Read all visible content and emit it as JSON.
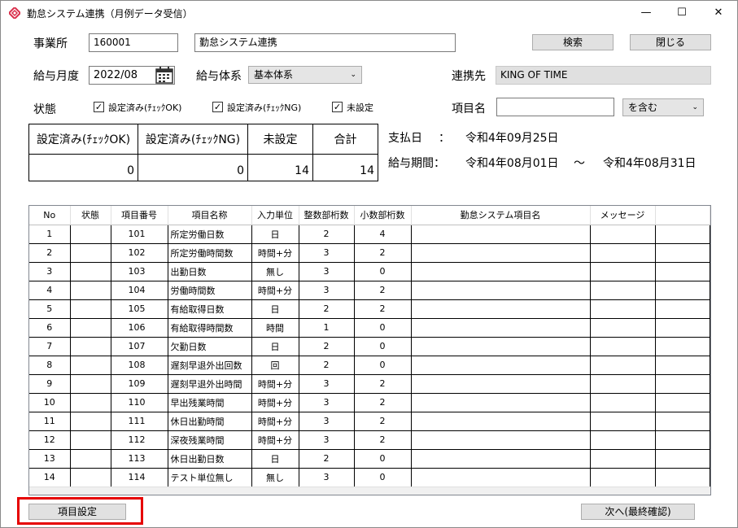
{
  "window": {
    "title": "勤怠システム連携（月例データ受信）",
    "minimize": "—",
    "maximize": "☐",
    "close": "✕"
  },
  "form": {
    "office_label": "事業所",
    "office_code": "160001",
    "office_name": "勤怠システム連携",
    "search_label": "検索",
    "close_label": "閉じる",
    "pay_month_label": "給与月度",
    "pay_month_value": "2022/08",
    "pay_system_label": "給与体系",
    "pay_system_value": "基本体系",
    "link_label": "連携先",
    "link_value": "KING OF TIME",
    "status_label": "状態",
    "check_ok_label": "設定済み(ﾁｪｯｸOK)",
    "check_ng_label": "設定済み(ﾁｪｯｸNG)",
    "unset_label": "未設定",
    "item_name_label": "項目名",
    "item_name_value": "",
    "match_value": "を含む"
  },
  "summary": {
    "headers": [
      "設定済み(ﾁｪｯｸOK)",
      "設定済み(ﾁｪｯｸNG)",
      "未設定",
      "合計"
    ],
    "values": [
      "0",
      "0",
      "14",
      "14"
    ]
  },
  "info": {
    "pay_date_label": "支払日",
    "pay_date_sep": "：",
    "pay_date_value": "令和4年09月25日",
    "period_label": "給与期間：",
    "period_from": "令和4年08月01日",
    "period_sep": "〜",
    "period_to": "令和4年08月31日"
  },
  "grid": {
    "columns": [
      "No",
      "状態",
      "項目番号",
      "項目名称",
      "入力単位",
      "整数部桁数",
      "小数部桁数",
      "勤怠システム項目名",
      "メッセージ"
    ],
    "rows": [
      [
        "1",
        "",
        "101",
        "所定労働日数",
        "日",
        "2",
        "4",
        "",
        ""
      ],
      [
        "2",
        "",
        "102",
        "所定労働時間数",
        "時間+分",
        "3",
        "2",
        "",
        ""
      ],
      [
        "3",
        "",
        "103",
        "出勤日数",
        "無し",
        "3",
        "0",
        "",
        ""
      ],
      [
        "4",
        "",
        "104",
        "労働時間数",
        "時間+分",
        "3",
        "2",
        "",
        ""
      ],
      [
        "5",
        "",
        "105",
        "有給取得日数",
        "日",
        "2",
        "2",
        "",
        ""
      ],
      [
        "6",
        "",
        "106",
        "有給取得時間数",
        "時間",
        "1",
        "0",
        "",
        ""
      ],
      [
        "7",
        "",
        "107",
        "欠勤日数",
        "日",
        "2",
        "0",
        "",
        ""
      ],
      [
        "8",
        "",
        "108",
        "遅刻早退外出回数",
        "回",
        "2",
        "0",
        "",
        ""
      ],
      [
        "9",
        "",
        "109",
        "遅刻早退外出時間",
        "時間+分",
        "3",
        "2",
        "",
        ""
      ],
      [
        "10",
        "",
        "110",
        "早出残業時間",
        "時間+分",
        "3",
        "2",
        "",
        ""
      ],
      [
        "11",
        "",
        "111",
        "休日出勤時間",
        "時間+分",
        "3",
        "2",
        "",
        ""
      ],
      [
        "12",
        "",
        "112",
        "深夜残業時間",
        "時間+分",
        "3",
        "2",
        "",
        ""
      ],
      [
        "13",
        "",
        "113",
        "休日出勤日数",
        "日",
        "2",
        "0",
        "",
        ""
      ],
      [
        "14",
        "",
        "114",
        "テスト単位無し",
        "無し",
        "3",
        "0",
        "",
        ""
      ]
    ]
  },
  "footer": {
    "item_setting_label": "項目設定",
    "next_label": "次へ(最終確認)"
  },
  "colors": {
    "highlight": "#e60000",
    "app_icon": "#d9304c"
  }
}
